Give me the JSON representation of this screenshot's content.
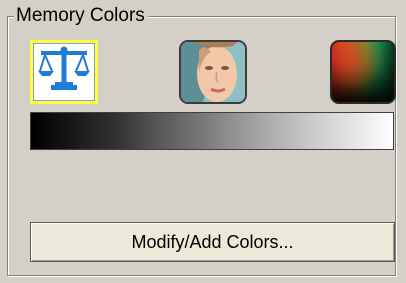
{
  "group": {
    "title": "Memory Colors"
  },
  "icons": [
    {
      "name": "balance-scale-icon",
      "selected": true
    },
    {
      "name": "face-icon",
      "selected": false
    },
    {
      "name": "color-spectrum-icon",
      "selected": false
    }
  ],
  "colors": {
    "selection_highlight": "#ffff33",
    "balance_icon": "#1f7ad8",
    "button_face": "#ece9d8",
    "panel_background": "#d4d0c8"
  },
  "modify_button": {
    "label": "Modify/Add Colors..."
  }
}
